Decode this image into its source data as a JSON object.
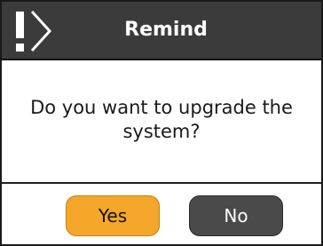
{
  "dialog": {
    "title": "Remind",
    "icon": "warning-exclamation-icon",
    "message": "Do you want to upgrade the system?",
    "buttons": {
      "yes_label": "Yes",
      "no_label": "No"
    }
  },
  "colors": {
    "header_background": "#3b3b3b",
    "yes_button": "#f4a72a",
    "no_button": "#4a4a4a"
  }
}
